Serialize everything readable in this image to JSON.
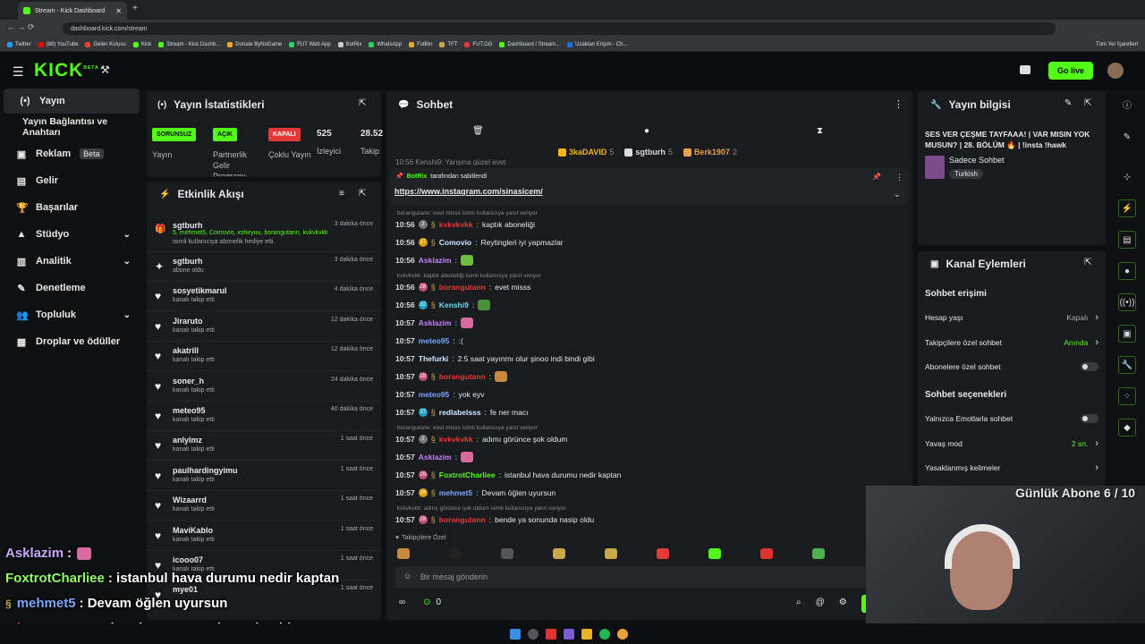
{
  "browser": {
    "tab_title": "Stream - Kick Dashboard",
    "url": "dashboard.kick.com/stream",
    "bookmarks": [
      "Twitter",
      "(88) YouTube",
      "Gelen Kutusu",
      "Kick",
      "Stream - Kick Dashb...",
      "Donate ByNoGame",
      "FUT Web App",
      "BotRix",
      "WhatsApp",
      "FutBin",
      "TFT",
      "FUT.GG",
      "Dashboard / Stream...",
      "Uzaktan Erişim - Ch..."
    ],
    "all_bookmarks": "Tüm Yer İşaretleri"
  },
  "header": {
    "logo": "KICK",
    "logo_sup": "BETA",
    "go_live": "Go live"
  },
  "nav": {
    "items": [
      {
        "label": "Yayın",
        "icon": "broadcast-icon"
      },
      {
        "label": "Yayın Bağlantısı ve Anahtarı"
      },
      {
        "label": "Reklam",
        "badge": "Beta"
      },
      {
        "label": "Gelir"
      },
      {
        "label": "Başarılar"
      },
      {
        "label": "Stüdyo"
      },
      {
        "label": "Analitik"
      },
      {
        "label": "Denetleme"
      },
      {
        "label": "Topluluk"
      },
      {
        "label": "Droplar ve ödüller"
      }
    ]
  },
  "stats": {
    "title": "Yayın İstatistikleri",
    "badges": [
      {
        "text": "SORUNSUZ",
        "label": "Yayın",
        "color": "#53fc18"
      },
      {
        "text": "AÇIK",
        "label": "Partnerlik Gelir Programı",
        "color": "#53fc18"
      },
      {
        "text": "KAPALI",
        "label": "Çoklu Yayın",
        "color": "#e53935"
      }
    ],
    "viewers": "525",
    "viewers_label": "İzleyici",
    "followers": "28.52",
    "followers_label": "Takip"
  },
  "activity": {
    "title": "Etkinlik Akışı",
    "first": {
      "name": "sgtburh",
      "time": "3 dakika önce",
      "line1": "5, mehmet5, Comovio, xshiryuu, borangutann, kvkvkvkk",
      "line2": "isimli kullanıcıya abonelik hediye etti."
    },
    "rows": [
      {
        "name": "sgtburh",
        "sub": "abone oldu",
        "time": "3 dakika önce"
      },
      {
        "name": "sosyetikmarul",
        "sub": "kanalı takip etti",
        "time": "4 dakika önce"
      },
      {
        "name": "Jiraruto",
        "sub": "kanalı takip etti",
        "time": "12 dakika önce"
      },
      {
        "name": "akatrill",
        "sub": "kanalı takip etti",
        "time": "12 dakika önce"
      },
      {
        "name": "soner_h",
        "sub": "kanalı takip etti",
        "time": "24 dakika önce"
      },
      {
        "name": "meteo95",
        "sub": "kanalı takip etti",
        "time": "40 dakika önce"
      },
      {
        "name": "anlylmz",
        "sub": "kanalı takip etti",
        "time": "1 saat önce"
      },
      {
        "name": "paulhardingyimu",
        "sub": "kanalı takip etti",
        "time": "1 saat önce"
      },
      {
        "name": "Wizaarrd",
        "sub": "kanalı takip etti",
        "time": "1 saat önce"
      },
      {
        "name": "MaviKablo",
        "sub": "kanalı takip etti",
        "time": "1 saat önce"
      },
      {
        "name": "icooo07",
        "sub": "kanalı takip etti",
        "time": "1 saat önce"
      },
      {
        "name": "mye01",
        "sub": "",
        "time": "1 saat önce"
      }
    ]
  },
  "chat": {
    "title": "Sohbet",
    "leaders": [
      {
        "name": "3kaDAVID",
        "n": "5",
        "color": "#f5b51c"
      },
      {
        "name": "sgtburh",
        "n": "5",
        "color": "#dddddd"
      },
      {
        "name": "Berk1907",
        "n": "2",
        "color": "#e8a24c"
      }
    ],
    "partial": "Kenshi9: Yarışma güzel evet",
    "partial_time": "10:56",
    "pinned_by": "BotRix",
    "pinned_suffix": "tarafından sabitlendi",
    "pinned_link": "https://www.instagram.com/sinasicem/",
    "messages": [
      {
        "reply": "borangutann: evet misss isimli kullanıcıya yanıt veriyor"
      },
      {
        "t": "10:56",
        "b": "2",
        "bc": "#777",
        "u": "kvkvkvkk",
        "uc": "#e53935",
        "m": "kaptık aboneliği"
      },
      {
        "t": "10:56",
        "b": "17",
        "bc": "#d9a000",
        "u": "Comovio",
        "uc": "#cfe8ff",
        "m": "Reytingleri iyi yapmazlar"
      },
      {
        "t": "10:56",
        "u": "Asklazim",
        "uc": "#c084fc",
        "m": "",
        "emote": "#6abf40"
      },
      {
        "reply": "kvkvkvkk: kaptık aboneliği isimli kullanıcıya yanıt veriyor"
      },
      {
        "t": "10:56",
        "b": "28",
        "bc": "#c0507a",
        "u": "borangutann",
        "uc": "#e53935",
        "m": "evet misss"
      },
      {
        "t": "10:56",
        "b": "32",
        "bc": "#1fa0c0",
        "u": "Kenshi9",
        "uc": "#6fd7f0",
        "m": "",
        "emote": "#4b8f3a"
      },
      {
        "t": "10:57",
        "u": "Asklazim",
        "uc": "#c084fc",
        "m": "",
        "emote": "#d86aa0"
      },
      {
        "t": "10:57",
        "u": "meteo95",
        "uc": "#7aa6ff",
        "m": ":("
      },
      {
        "t": "10:57",
        "u": "Thefurki",
        "uc": "#cfe8ff",
        "m": "2.5 saat yayınmı olur şinoo indi bindi gibi"
      },
      {
        "t": "10:57",
        "b": "28",
        "bc": "#c0507a",
        "u": "borangutann",
        "uc": "#e53935",
        "m": "",
        "emote": "#c58a3a"
      },
      {
        "t": "10:57",
        "u": "meteo95",
        "uc": "#7aa6ff",
        "m": "yok eyv"
      },
      {
        "t": "10:57",
        "b": "37",
        "bc": "#1fa0c0",
        "u": "redlabelsss",
        "uc": "#cfe8ff",
        "m": "fe ner macı"
      },
      {
        "reply": "borangutann: evet misss isimli kullanıcıya yanıt veriyor"
      },
      {
        "t": "10:57",
        "b": "2",
        "bc": "#777",
        "u": "kvkvkvkk",
        "uc": "#e53935",
        "m": "adımı görünce şok oldum"
      },
      {
        "t": "10:57",
        "u": "Asklazim",
        "uc": "#c084fc",
        "m": "",
        "emote": "#d86aa0"
      },
      {
        "t": "10:57",
        "b": "28",
        "bc": "#c0507a",
        "u": "FoxtrotCharliee",
        "uc": "#53fc18",
        "m": "istanbul hava durumu nedir kaptan"
      },
      {
        "t": "10:57",
        "b": "16",
        "bc": "#d9a000",
        "u": "mehmet5",
        "uc": "#7aa6ff",
        "m": "Devam öğlen uyursun"
      },
      {
        "reply": "kvkvkvkk: adımı görünce şok oldum isimli kullanıcıya yanıt veriyor"
      },
      {
        "t": "10:57",
        "b": "28",
        "bc": "#c0507a",
        "u": "borangutann",
        "uc": "#e53935",
        "m": "bende ya sonunda nasip oldu"
      }
    ],
    "followers_only_label": "Takipçilere Özel",
    "input_placeholder": "Bir mesaj gönderin",
    "viewer_count": "0"
  },
  "info": {
    "title": "Yayın bilgisi",
    "stream_title": "SES VER ÇEŞME TAYFAAA! | VAR MISIN YOK MUSUN? | 28. BÖLÜM 🔥 | !insta !hawk",
    "category": "Sadece Sohbet",
    "tag": "Turkish"
  },
  "actions": {
    "title": "Kanal Eylemleri",
    "access_title": "Sohbet erişimi",
    "rows": [
      {
        "label": "Hesap yaşı",
        "value": "Kapalı",
        "type": "link",
        "vc": "#aaaaaa"
      },
      {
        "label": "Takipçilere özel sohbet",
        "value": "Anında",
        "type": "link",
        "vc": "#53fc18"
      },
      {
        "label": "Abonelere özel sohbet",
        "type": "toggle"
      }
    ],
    "options_title": "Sohbet seçenekleri",
    "rows2": [
      {
        "label": "Yalnızca Emotlarla sohbet",
        "type": "toggle"
      },
      {
        "label": "Yavaş mod",
        "value": "2 sn.",
        "type": "link",
        "vc": "#53fc18"
      },
      {
        "label": "Yasaklanmış kelimeler",
        "type": "link"
      }
    ]
  },
  "overlay": {
    "goal": "Günlük Abone 6 / 10",
    "lines": [
      {
        "u": "Asklazim",
        "uc": "#c9a7ff",
        "m": ":"
      },
      {
        "u": "FoxtrotCharliee",
        "uc": "#8fff6a",
        "m": ": istanbul hava durumu nedir kaptan"
      },
      {
        "u": "mehmet5",
        "uc": "#7aa6ff",
        "m": ": Devam öğlen uyursun"
      },
      {
        "u": "borangutann",
        "uc": "#ff4a4a",
        "m": ": bende ya sonunda nasip oldu"
      }
    ]
  },
  "colors": {
    "accent": "#53fc18",
    "panel": "#191b1f",
    "bg": "#0f1011"
  }
}
